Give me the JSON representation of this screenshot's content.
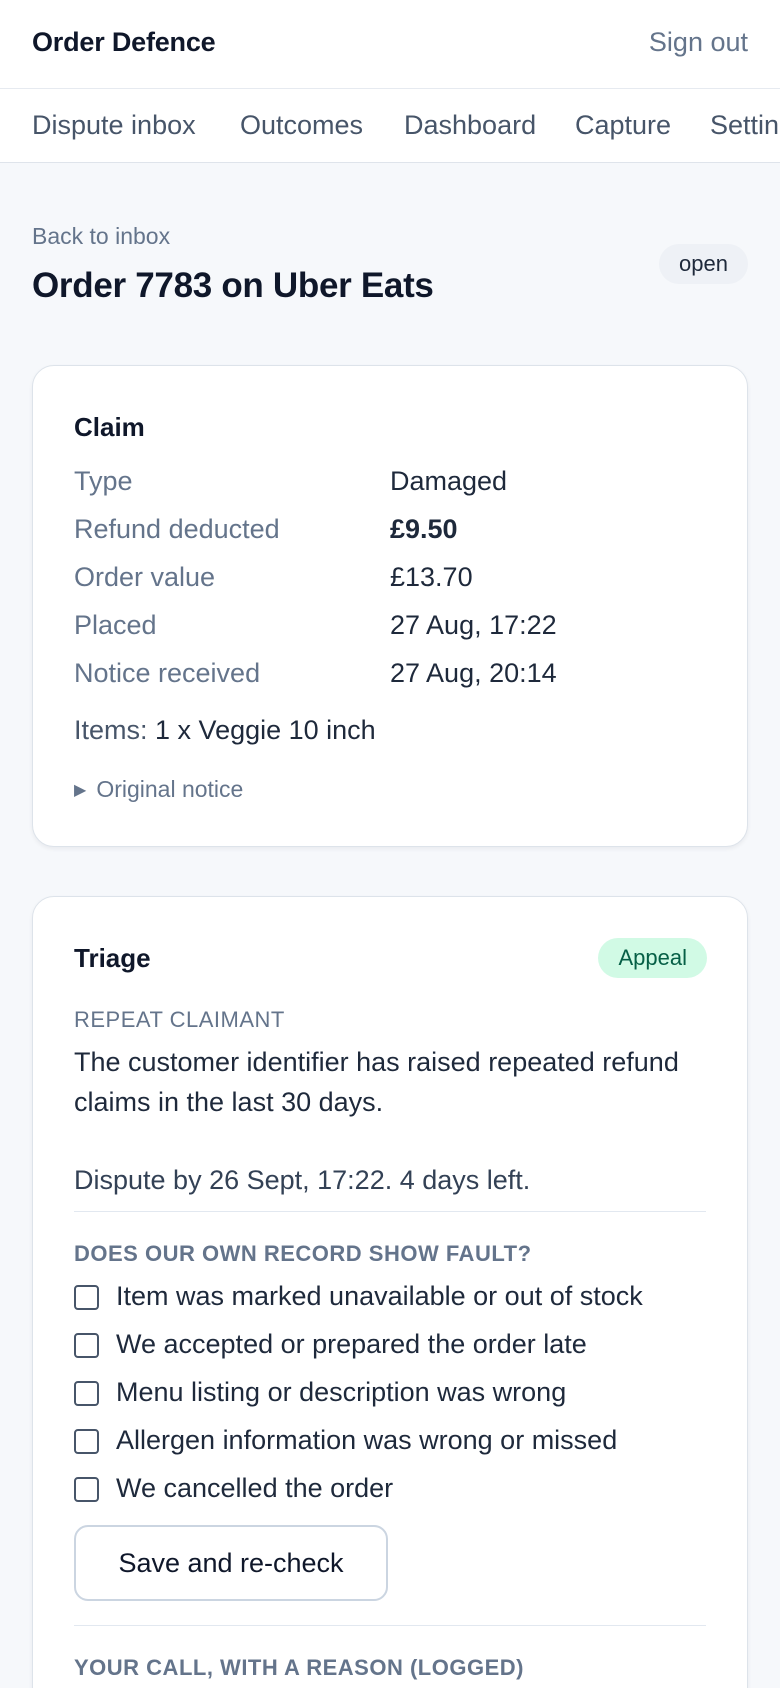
{
  "header": {
    "brand": "Order Defence",
    "sign_out": "Sign out"
  },
  "nav": {
    "items": [
      "Dispute inbox",
      "Outcomes",
      "Dashboard",
      "Capture",
      "Settings"
    ]
  },
  "page": {
    "back_link": "Back to inbox",
    "title": "Order 7783 on Uber Eats",
    "status": "open"
  },
  "claim": {
    "title": "Claim",
    "rows": [
      {
        "label": "Type",
        "value": "Damaged"
      },
      {
        "label": "Refund deducted",
        "value": "£9.50"
      },
      {
        "label": "Order value",
        "value": "£13.70"
      },
      {
        "label": "Placed",
        "value": "27 Aug, 17:22"
      },
      {
        "label": "Notice received",
        "value": "27 Aug, 20:14"
      }
    ],
    "items_label": "Items:",
    "items_value": "1 x Veggie 10 inch",
    "original_notice": "Original notice"
  },
  "triage": {
    "title": "Triage",
    "badge": "Appeal",
    "kicker": "REPEAT CLAIMANT",
    "description": "The customer identifier has raised repeated refund claims in the last 30 days.",
    "deadline": "Dispute by 26 Sept, 17:22. 4 days left.",
    "fault_heading": "DOES OUR OWN RECORD SHOW FAULT?",
    "checks": [
      {
        "label": "Item was marked unavailable or out of stock",
        "checked": false
      },
      {
        "label": "We accepted or prepared the order late",
        "checked": false
      },
      {
        "label": "Menu listing or description was wrong",
        "checked": false
      },
      {
        "label": "Allergen information was wrong or missed",
        "checked": false
      },
      {
        "label": "We cancelled the order",
        "checked": false
      }
    ],
    "save_button": "Save and re-check",
    "call_heading": "YOUR CALL, WITH A REASON (LOGGED)"
  },
  "colors": {
    "background": "#f6f8fb",
    "badge_appeal_bg": "#d1fae5",
    "badge_appeal_text": "#065f46",
    "muted_text": "#64748b"
  }
}
